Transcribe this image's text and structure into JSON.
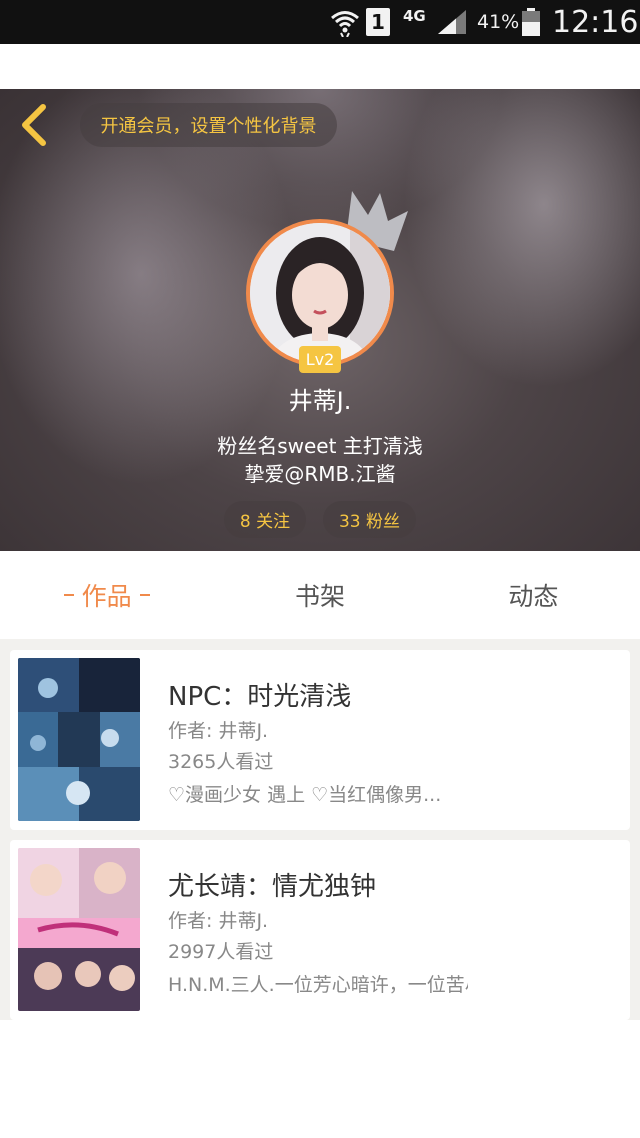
{
  "status_bar": {
    "sim": "1",
    "network": "4G",
    "battery": "41%",
    "time": "12:16"
  },
  "header": {
    "vip_banner": "开通会员，设置个性化背景"
  },
  "profile": {
    "level": "Lv2",
    "name": "井蒂J.",
    "bio_line1": "粉丝名sweet  主打清浅",
    "bio_line2": "挚爱@RMB.江酱",
    "following": "8 关注",
    "fans": "33 粉丝"
  },
  "tabs": [
    {
      "label": "作品",
      "active": true
    },
    {
      "label": "书架",
      "active": false
    },
    {
      "label": "动态",
      "active": false
    }
  ],
  "works": [
    {
      "title": "NPC：时光清浅",
      "author": "作者: 井蒂J.",
      "views": "3265人看过",
      "desc": "♡漫画少女 遇上 ♡当红偶像男..."
    },
    {
      "title": "尤长靖：情尤独钟",
      "author": "作者: 井蒂J.",
      "views": "2997人看过",
      "desc": "H.N.M.三人.一位芳心暗许，一位苦尽…"
    }
  ],
  "colors": {
    "accent": "#f08a4b",
    "gold": "#f5c542",
    "status_bar": "#111111"
  }
}
